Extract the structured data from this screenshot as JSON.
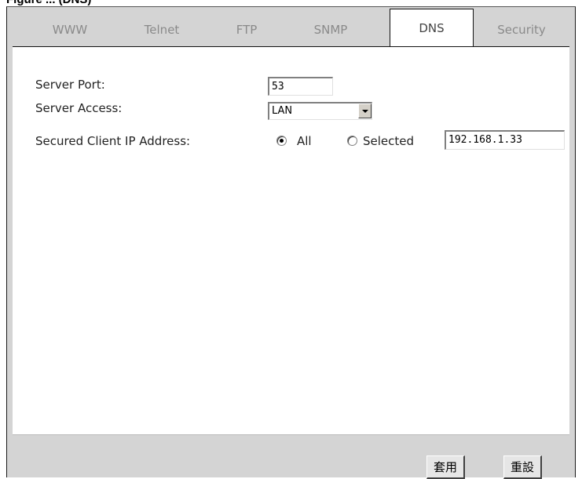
{
  "caption": "Figure ... (DNS)",
  "tabs": [
    {
      "label": "WWW",
      "active": false
    },
    {
      "label": "Telnet",
      "active": false
    },
    {
      "label": "FTP",
      "active": false
    },
    {
      "label": "SNMP",
      "active": false
    },
    {
      "label": "DNS",
      "active": true
    },
    {
      "label": "Security",
      "active": false
    }
  ],
  "form": {
    "server_port_label": "Server Port:",
    "server_port_value": "53",
    "server_access_label": "Server Access:",
    "server_access_value": "LAN",
    "secured_ip_label": "Secured Client IP Address:",
    "radio_all_label": "All",
    "radio_selected_label": "Selected",
    "radio_checked": "All",
    "selected_ip_value": "192.168.1.33"
  },
  "buttons": {
    "apply_label": "套用",
    "reset_label": "重設"
  }
}
